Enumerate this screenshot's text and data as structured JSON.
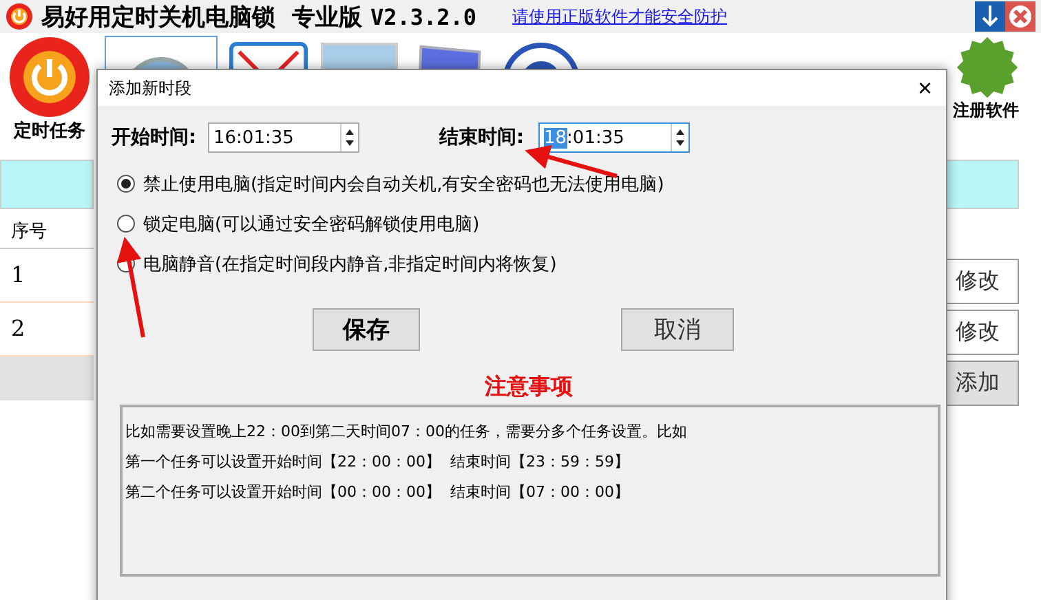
{
  "app": {
    "title": "易好用定时关机电脑锁",
    "edition": "专业版",
    "version": "V2.3.2.0",
    "link": "请使用正版软件才能安全防护"
  },
  "toolbar": {
    "timer_task": "定时任务",
    "register": "注册软件"
  },
  "table": {
    "column": "序号",
    "rows": [
      {
        "index": "1",
        "action": "修改"
      },
      {
        "index": "2",
        "action": "修改"
      }
    ],
    "add_button": "添加"
  },
  "dialog": {
    "title": "添加新时段",
    "close": "×",
    "start_label": "开始时间:",
    "start_value": "16:01:35",
    "end_label": "结束时间:",
    "end_selection": "18",
    "end_rest": ":01:35",
    "options": [
      {
        "label": "禁止使用电脑(指定时间内会自动关机,有安全密码也无法使用电脑)",
        "selected": true
      },
      {
        "label": "锁定电脑(可以通过安全密码解锁使用电脑)",
        "selected": false
      },
      {
        "label": "电脑静音(在指定时间段内静音,非指定时间内将恢复)",
        "selected": false
      }
    ],
    "buttons": [
      {
        "label": "保存",
        "kind": "primary"
      },
      {
        "label": "取消",
        "kind": "plain"
      }
    ],
    "notes_title": "注意事项",
    "notes": [
      "比如需要设置晚上22：00到第二天时间07：00的任务，需要分多个任务设置。比如",
      "第一个任务可以设置开始时间【22：00：00】  结束时间【23：59：59】",
      "第二个任务可以设置开始时间【00：00：00】  结束时间【07：00：00】"
    ]
  }
}
